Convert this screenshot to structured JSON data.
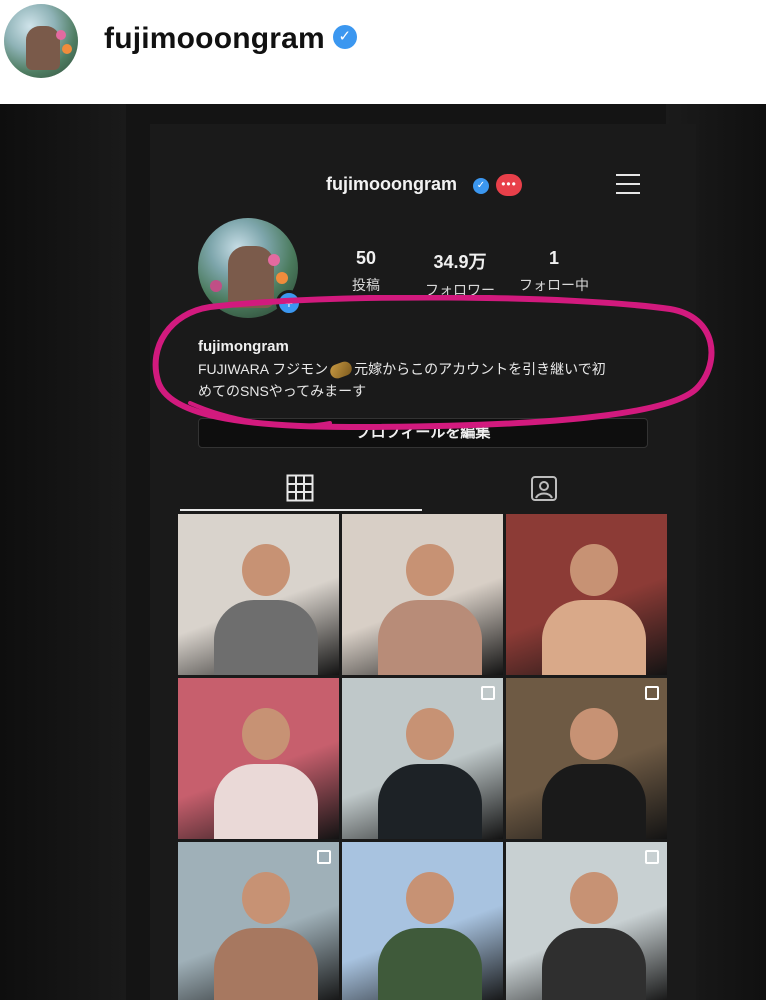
{
  "post": {
    "username": "fujimooongram",
    "verified_mark": "✓"
  },
  "profile": {
    "top_username": "fujimooongram",
    "verified_mark": "✓",
    "notification_badge": "•••",
    "add_story_mark": "+",
    "stats": [
      {
        "value": "50",
        "label": "投稿"
      },
      {
        "value": "34.9万",
        "label": "フォロワー"
      },
      {
        "value": "1",
        "label": "フォロー中"
      }
    ],
    "bio_name": "fujimongram",
    "bio_line1_a": "FUJIWARA フジモン",
    "bio_line1_b": "元嫁からこのアカウントを引き継いで初",
    "bio_line2": "めてのSNSやってみまーす",
    "edit_profile_label": "プロフィールを編集"
  },
  "icons": [
    "verified-icon",
    "menu-icon",
    "grid-icon",
    "tagged-icon",
    "multi-photo-icon",
    "emoji-icon"
  ],
  "colors": {
    "highlight": "#d21a7e",
    "verified": "#3b97f0",
    "badge": "#e8404a",
    "screen_bg": "#1a1a1a"
  },
  "grid_tiles": [
    {
      "multi": false,
      "bg": "#d9d3cc",
      "accent": "#6e6e6e"
    },
    {
      "multi": false,
      "bg": "#d8cfc6",
      "accent": "#b88c78"
    },
    {
      "multi": false,
      "bg": "#8c3b36",
      "accent": "#d9a989"
    },
    {
      "multi": false,
      "bg": "#c75f6d",
      "accent": "#ead9d7"
    },
    {
      "multi": true,
      "bg": "#bfc8c9",
      "accent": "#1d2226"
    },
    {
      "multi": true,
      "bg": "#6e5a44",
      "accent": "#1a1a1a"
    },
    {
      "multi": true,
      "bg": "#9fb0b8",
      "accent": "#a77860"
    },
    {
      "multi": false,
      "bg": "#a8c3e0",
      "accent": "#3f5a3a"
    },
    {
      "multi": true,
      "bg": "#c8d0d2",
      "accent": "#2f2f2f"
    }
  ]
}
